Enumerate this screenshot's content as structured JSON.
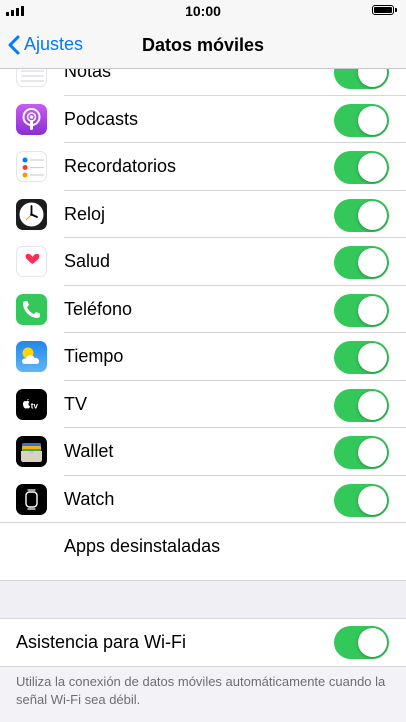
{
  "status_bar": {
    "time": "10:00"
  },
  "nav": {
    "back_label": "Ajustes",
    "title": "Datos móviles"
  },
  "apps": [
    {
      "label": "Notas",
      "icon": "notes-icon",
      "enabled": true
    },
    {
      "label": "Podcasts",
      "icon": "podcasts-icon",
      "enabled": true
    },
    {
      "label": "Recordatorios",
      "icon": "reminders-icon",
      "enabled": true
    },
    {
      "label": "Reloj",
      "icon": "clock-icon",
      "enabled": true
    },
    {
      "label": "Salud",
      "icon": "health-icon",
      "enabled": true
    },
    {
      "label": "Teléfono",
      "icon": "phone-icon",
      "enabled": true
    },
    {
      "label": "Tiempo",
      "icon": "weather-icon",
      "enabled": true
    },
    {
      "label": "TV",
      "icon": "tv-icon",
      "enabled": true
    },
    {
      "label": "Wallet",
      "icon": "wallet-icon",
      "enabled": true
    },
    {
      "label": "Watch",
      "icon": "watch-icon",
      "enabled": true
    }
  ],
  "uninstalled_label": "Apps desinstaladas",
  "wifi_assist": {
    "label": "Asistencia para Wi-Fi",
    "enabled": true
  },
  "footer_note": "Utiliza la conexión de datos móviles automáticamente cuando la señal Wi-Fi sea débil.",
  "colors": {
    "accent": "#007aff",
    "toggle_on": "#34c759"
  }
}
